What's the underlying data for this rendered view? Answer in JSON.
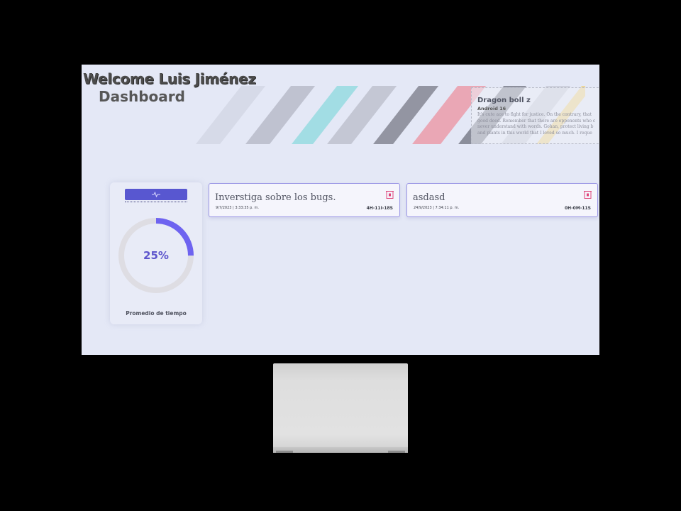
{
  "header": {
    "welcome": "Welcome Luis Jiménez",
    "subtitle": "Dashboard"
  },
  "featured": {
    "title": "Dragon boll z",
    "subtitle": "Android 16",
    "description_lines": [
      "It's cute ace to fight for justice. On the contrary, that",
      "good deed. Remember that there are opponents who c",
      "never understand with words. Gohan, protect living b",
      "and plants in this world that I loved so much. I reque"
    ]
  },
  "stats": {
    "percent_label": "25%",
    "percent_value": 25,
    "label": "Promedio de tiempo",
    "icon": "activity-icon"
  },
  "tasks": [
    {
      "title": "Inverstiga sobre los bugs.",
      "date": "9/7/2023 | 3:33:35 p. m.",
      "code": "4H-11I-18S",
      "icon": "trash-icon"
    },
    {
      "title": "asdasd",
      "date": "24/9/2023 | 7:34:11 p. m.",
      "code": "0H-0M-11S",
      "icon": "trash-icon"
    }
  ],
  "colors": {
    "accent": "#5857d0",
    "progress": "#6e63f0",
    "track": "#dedde3",
    "delete": "#e0457a",
    "screen_bg": "#e4e8f6"
  }
}
